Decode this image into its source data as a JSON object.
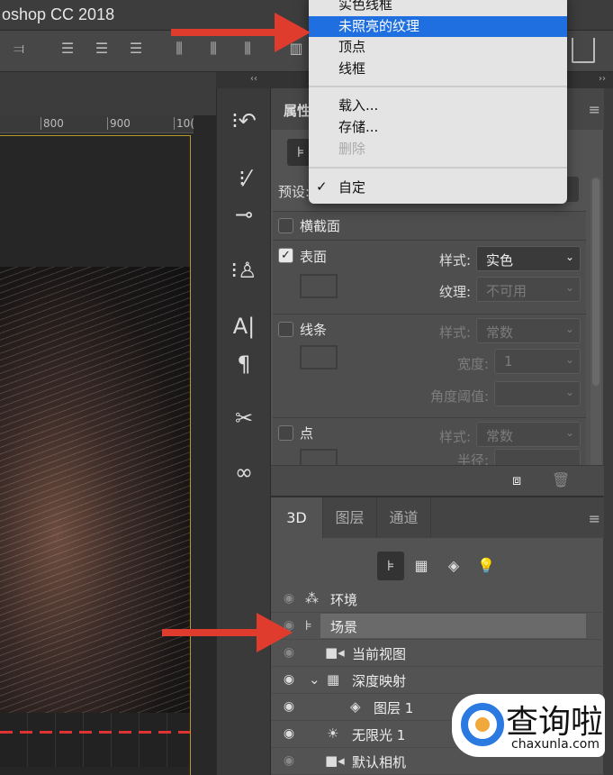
{
  "window": {
    "title": "oshop CC 2018"
  },
  "ruler": {
    "ticks": [
      "800",
      "900",
      "10("
    ]
  },
  "dropdown_menu": {
    "items": [
      {
        "label": "实色线框",
        "state": "normal"
      },
      {
        "label": "未照亮的纹理",
        "state": "highlighted"
      },
      {
        "label": "顶点",
        "state": "normal"
      },
      {
        "label": "线框",
        "state": "normal"
      },
      {
        "label": "载入...",
        "state": "normal"
      },
      {
        "label": "存储...",
        "state": "normal"
      },
      {
        "label": "删除",
        "state": "disabled"
      },
      {
        "label": "自定",
        "state": "checked"
      }
    ],
    "check_glyph": "✓"
  },
  "properties": {
    "title": "属性",
    "preset_label": "预设:",
    "sections": {
      "cross_section": {
        "label": "横截面",
        "checked": false
      },
      "surface": {
        "label": "表面",
        "checked": true,
        "style_label": "样式:",
        "style_value": "实色",
        "texture_label": "纹理:",
        "texture_value": "不可用"
      },
      "lines": {
        "label": "线条",
        "checked": false,
        "style_label": "样式:",
        "style_value": "常数",
        "width_label": "宽度:",
        "width_value": "1",
        "angle_label": "角度阈值:"
      },
      "points": {
        "label": "点",
        "checked": false,
        "style_label": "样式:",
        "style_value": "常数",
        "radius_label": "半径:"
      }
    }
  },
  "panel_3d": {
    "tabs": [
      "3D",
      "图层",
      "通道"
    ],
    "active_tab": "3D",
    "rows": [
      {
        "label": "环境",
        "icon": "environment-icon",
        "visible": false
      },
      {
        "label": "场景",
        "icon": "scene-icon",
        "visible": false,
        "selected": true
      },
      {
        "label": "当前视图",
        "icon": "camera-icon",
        "visible": false
      },
      {
        "label": "深度映射",
        "icon": "mesh-icon",
        "visible": true,
        "expanded": true
      },
      {
        "label": "图层 1",
        "icon": "material-icon",
        "visible": true
      },
      {
        "label": "无限光 1",
        "icon": "light-icon",
        "visible": true
      },
      {
        "label": "默认相机",
        "icon": "camera-icon",
        "visible": false
      }
    ]
  },
  "watermark": {
    "text": "查询啦",
    "url": "chaxunla.com"
  },
  "colors": {
    "highlight": "#1f6fe0",
    "arrow": "#e03c2e",
    "panel": "#535353"
  }
}
